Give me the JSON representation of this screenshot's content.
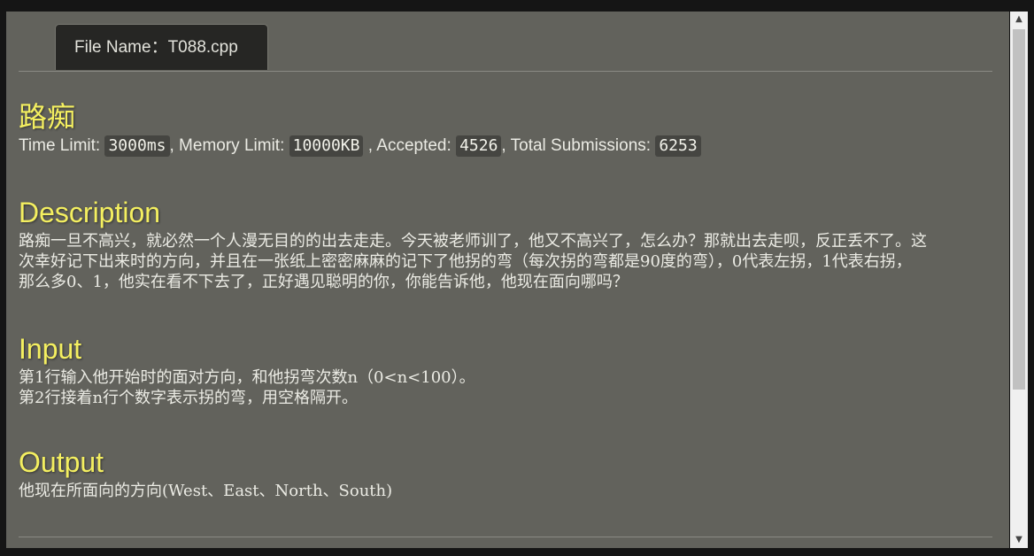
{
  "tab": {
    "label": "File Name：T088.cpp"
  },
  "problem": {
    "title": "路痴",
    "meta": {
      "time_label": "Time Limit: ",
      "time_value": "3000ms",
      "memory_label": ", Memory Limit: ",
      "memory_value": "10000KB",
      "accepted_label": " , Accepted: ",
      "accepted_value": "4526",
      "submissions_label": ", Total Submissions: ",
      "submissions_value": "6253"
    }
  },
  "sections": {
    "description": {
      "heading": "Description",
      "lines": [
        "路痴一旦不高兴，就必然一个人漫无目的的出去走走。今天被老师训了，他又不高兴了，怎么办？那就出去走呗，反正丢不了。这",
        "次幸好记下出来时的方向，并且在一张纸上密密麻麻的记下了他拐的弯（每次拐的弯都是90度的弯），0代表左拐，1代表右拐，",
        "那么多0、1，他实在看不下去了，正好遇见聪明的你，你能告诉他，他现在面向哪吗？"
      ]
    },
    "input": {
      "heading": "Input",
      "lines": [
        "第1行输入他开始时的面对方向，和他拐弯次数n（0<n<100）。",
        "第2行接着n行个数字表示拐的弯，用空格隔开。"
      ]
    },
    "output": {
      "heading": "Output",
      "lines": [
        "他现在所面向的方向(West、East、North、South)"
      ]
    }
  },
  "colors": {
    "background": "#62625c",
    "heading": "#f4ef60",
    "text": "#ebebe4",
    "tab": "#262624",
    "code_background": "#454541"
  },
  "scrollbar": {
    "up_icon": "triangle-up",
    "down_icon": "triangle-down"
  }
}
